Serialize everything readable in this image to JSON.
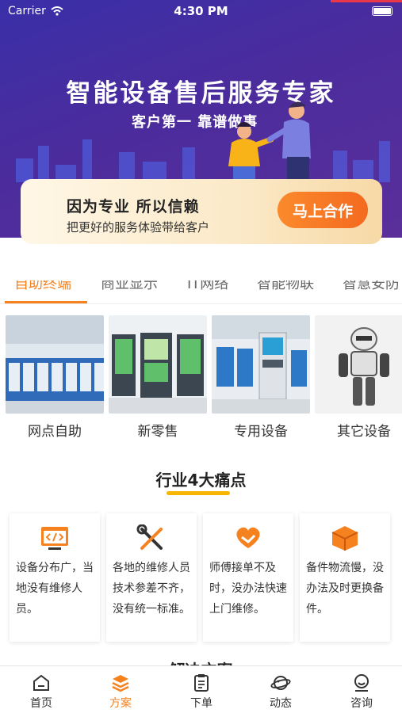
{
  "status_bar": {
    "carrier": "Carrier",
    "time": "4:30 PM"
  },
  "hero": {
    "title": "智能设备售后服务专家",
    "subtitle": "客户第一  靠谱做事"
  },
  "promo": {
    "headline": "因为专业    所以信赖",
    "description": "把更好的服务体验带给客户",
    "cta_label": "马上合作"
  },
  "category_tabs": [
    {
      "label": "自助终端",
      "active": true
    },
    {
      "label": "商业显示",
      "active": false
    },
    {
      "label": "IT网络",
      "active": false
    },
    {
      "label": "智能物联",
      "active": false
    },
    {
      "label": "智慧安防",
      "active": false
    }
  ],
  "categories": [
    {
      "label": "网点自助"
    },
    {
      "label": "新零售"
    },
    {
      "label": "专用设备"
    },
    {
      "label": "其它设备"
    }
  ],
  "pain_points": {
    "title": "行业4大痛点",
    "items": [
      {
        "icon": "code-window-icon",
        "text": "设备分布广，当地没有维修人员。"
      },
      {
        "icon": "tools-icon",
        "text": "各地的维修人员技术参差不齐，没有统一标准。"
      },
      {
        "icon": "heart-hand-icon",
        "text": "师傅接单不及时，没办法快速上门维修。"
      },
      {
        "icon": "package-box-icon",
        "text": "备件物流慢，没办法及时更换备件。"
      }
    ]
  },
  "next_section_title": "解决方案",
  "tabbar": [
    {
      "label": "首页",
      "icon": "home-icon",
      "active": false
    },
    {
      "label": "方案",
      "icon": "layers-icon",
      "active": true
    },
    {
      "label": "下单",
      "icon": "clipboard-icon",
      "active": false
    },
    {
      "label": "动态",
      "icon": "planet-icon",
      "active": false
    },
    {
      "label": "咨询",
      "icon": "support-agent-icon",
      "active": false
    }
  ],
  "colors": {
    "accent": "#f5821f",
    "hero_purple": "#4b2c9d",
    "highlight_yellow": "#f7b500"
  }
}
